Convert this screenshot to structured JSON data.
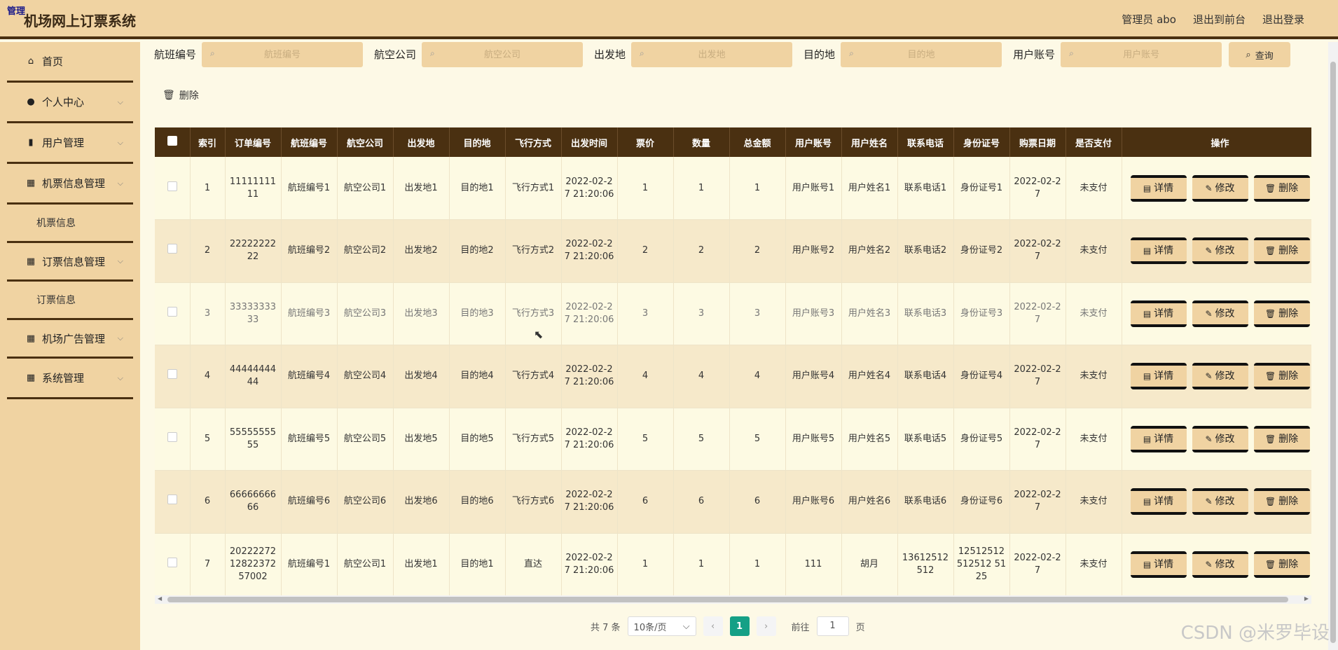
{
  "header": {
    "badge": "管理",
    "title": "机场网上订票系统",
    "admin_label": "管理员 abo",
    "exit_front": "退出到前台",
    "logout": "退出登录"
  },
  "sidebar": {
    "items": [
      {
        "label": "首页",
        "icon": "home-icon"
      },
      {
        "label": "个人中心",
        "icon": "user-icon"
      },
      {
        "label": "用户管理",
        "icon": "bar-chart-icon"
      },
      {
        "label": "机票信息管理",
        "icon": "grid-icon"
      },
      {
        "label": "机票信息"
      },
      {
        "label": "订票信息管理",
        "icon": "grid-icon"
      },
      {
        "label": "订票信息"
      },
      {
        "label": "机场广告管理",
        "icon": "grid-icon"
      },
      {
        "label": "系统管理",
        "icon": "grid-icon"
      }
    ]
  },
  "search": {
    "fields": [
      {
        "label": "航班编号",
        "placeholder": "航班编号"
      },
      {
        "label": "航空公司",
        "placeholder": "航空公司"
      },
      {
        "label": "出发地",
        "placeholder": "出发地"
      },
      {
        "label": "目的地",
        "placeholder": "目的地"
      },
      {
        "label": "用户账号",
        "placeholder": "用户账号"
      }
    ],
    "query_label": "查询"
  },
  "toolbar": {
    "delete_label": "删除"
  },
  "table": {
    "headers": [
      "索引",
      "订单编号",
      "航班编号",
      "航空公司",
      "出发地",
      "目的地",
      "飞行方式",
      "出发时间",
      "票价",
      "数量",
      "总金额",
      "用户账号",
      "用户姓名",
      "联系电话",
      "身份证号",
      "购票日期",
      "是否支付",
      "操作"
    ],
    "rows": [
      [
        "1",
        "1111111111",
        "航班编号1",
        "航空公司1",
        "出发地1",
        "目的地1",
        "飞行方式1",
        "2022-02-27 21:20:06",
        "1",
        "1",
        "1",
        "用户账号1",
        "用户姓名1",
        "联系电话1",
        "身份证号1",
        "2022-02-27",
        "未支付"
      ],
      [
        "2",
        "2222222222",
        "航班编号2",
        "航空公司2",
        "出发地2",
        "目的地2",
        "飞行方式2",
        "2022-02-27 21:20:06",
        "2",
        "2",
        "2",
        "用户账号2",
        "用户姓名2",
        "联系电话2",
        "身份证号2",
        "2022-02-27",
        "未支付"
      ],
      [
        "3",
        "3333333333",
        "航班编号3",
        "航空公司3",
        "出发地3",
        "目的地3",
        "飞行方式3",
        "2022-02-27 21:20:06",
        "3",
        "3",
        "3",
        "用户账号3",
        "用户姓名3",
        "联系电话3",
        "身份证号3",
        "2022-02-27",
        "未支付"
      ],
      [
        "4",
        "4444444444",
        "航班编号4",
        "航空公司4",
        "出发地4",
        "目的地4",
        "飞行方式4",
        "2022-02-27 21:20:06",
        "4",
        "4",
        "4",
        "用户账号4",
        "用户姓名4",
        "联系电话4",
        "身份证号4",
        "2022-02-27",
        "未支付"
      ],
      [
        "5",
        "5555555555",
        "航班编号5",
        "航空公司5",
        "出发地5",
        "目的地5",
        "飞行方式5",
        "2022-02-27 21:20:06",
        "5",
        "5",
        "5",
        "用户账号5",
        "用户姓名5",
        "联系电话5",
        "身份证号5",
        "2022-02-27",
        "未支付"
      ],
      [
        "6",
        "6666666666",
        "航班编号6",
        "航空公司6",
        "出发地6",
        "目的地6",
        "飞行方式6",
        "2022-02-27 21:20:06",
        "6",
        "6",
        "6",
        "用户账号6",
        "用户姓名6",
        "联系电话6",
        "身份证号6",
        "2022-02-27",
        "未支付"
      ],
      [
        "7",
        "202222721282237257002",
        "航班编号1",
        "航空公司1",
        "出发地1",
        "目的地1",
        "直达",
        "2022-02-27 21:20:06",
        "1",
        "1",
        "1",
        "111",
        "胡月",
        "13612512512",
        "12512512512512 5125",
        "2022-02-27",
        "未支付"
      ]
    ],
    "actions": {
      "detail": "详情",
      "edit": "修改",
      "delete": "删除"
    }
  },
  "pagination": {
    "total": "共 7 条",
    "page_size": "10条/页",
    "current_page": "1",
    "goto_prefix": "前往",
    "goto_value": "1",
    "goto_suffix": "页"
  },
  "watermark": "CSDN @米罗毕设",
  "colors": {
    "header_bg": "#f0d3a2",
    "dark_brown": "#4a3011",
    "page_bg": "#fdf9e6",
    "row_alt": "#f6e9ca",
    "pager_active": "#15a086"
  }
}
